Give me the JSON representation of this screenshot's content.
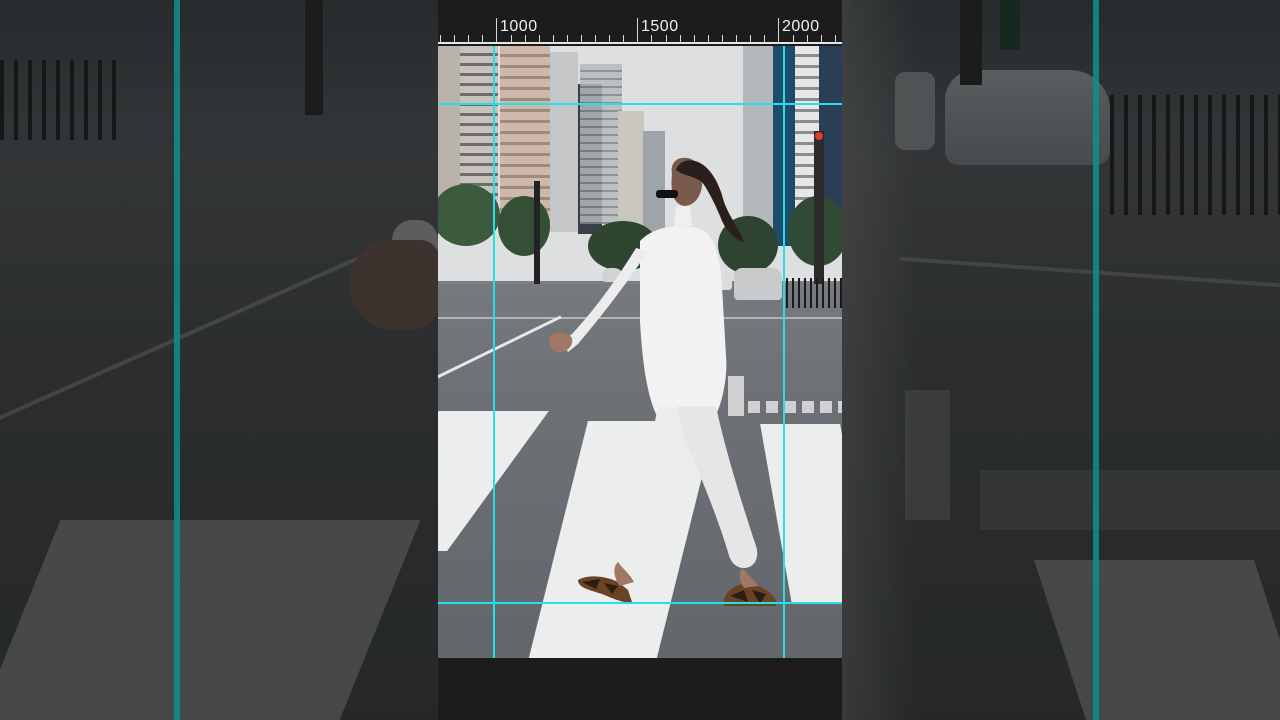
{
  "ruler": {
    "labels": [
      "1000",
      "1500",
      "2000"
    ]
  },
  "colors": {
    "guide": "#22e1e8",
    "background": "#1c1c1c",
    "ruler_text": "#f1f1f1"
  },
  "icons": {
    "guides": "crop-guide-lines",
    "preview": "video-frame-preview"
  }
}
